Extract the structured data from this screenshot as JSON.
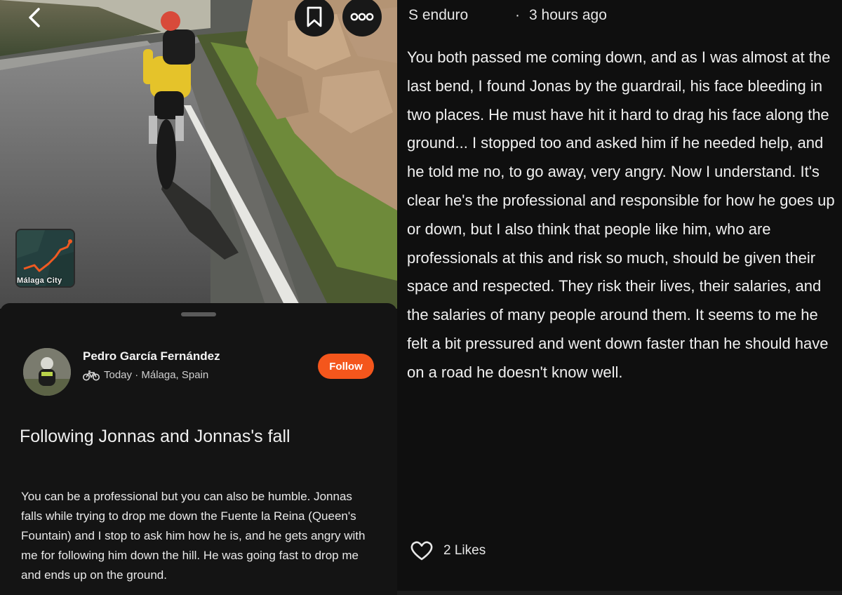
{
  "nav": {
    "back_icon": "chevron-left-icon",
    "bookmark_icon": "bookmark-icon",
    "more_icon": "more-dots-icon"
  },
  "map": {
    "label": "Málaga City"
  },
  "post": {
    "author": "Pedro García Fernández",
    "activity_icon": "bicycle-icon",
    "meta": "Today · Málaga, Spain",
    "follow_label": "Follow",
    "title": "Following Jonnas and Jonnas's fall",
    "body": "You can be a professional but you can also be humble. Jonnas falls while trying to drop me down the Fuente la Reina (Queen's Fountain) and I stop to ask him how he is, and he gets angry with me for following him down the hill. He was going fast to drop me and ends up on the ground."
  },
  "comment": {
    "user": "S enduro",
    "separator": "·",
    "time": "3 hours ago",
    "text": "You both passed me coming down, and as I was almost at the last bend, I found Jonas by the guardrail, his face bleeding in two places. He must have hit it hard to drag his face along the ground... I stopped too and asked him if he needed help, and he told me no, to go away, very angry. Now I understand. It's clear he's the professional and responsible for how he goes up or down, but I also think that people like him, who are professionals at this and risk so much, should be given their space and respected. They risk their lives, their salaries, and the salaries of many people around them. It seems to me he felt a bit pressured and went down faster than he should have on a road he doesn't know well.",
    "like_icon": "heart-icon",
    "likes": "2 Likes"
  },
  "colors": {
    "accent": "#f4561c",
    "background": "#0f0f0f",
    "sheet": "#141414",
    "route": "#f05a22"
  }
}
